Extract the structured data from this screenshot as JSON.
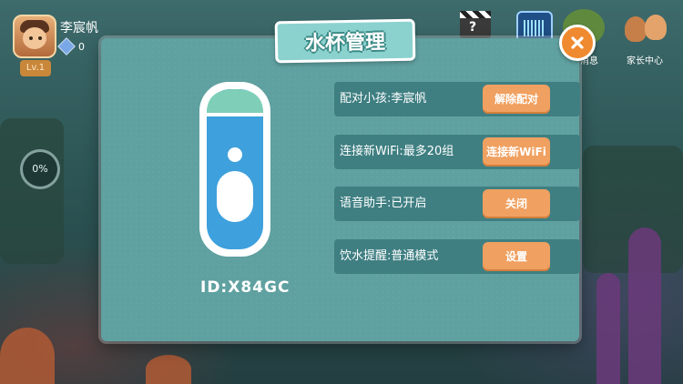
{
  "user": {
    "name": "李宸帆",
    "gems": "0",
    "level": "Lv.1"
  },
  "progress": {
    "value": "0%"
  },
  "top_icons": {
    "messages_label": "消息",
    "parent_center_label": "家长中心"
  },
  "modal": {
    "title": "水杯管理",
    "device_id": "ID:X84GC",
    "rows": [
      {
        "label": "配对小孩:李宸帆",
        "button": "解除配对"
      },
      {
        "label": "连接新WiFi:最多20组",
        "button": "连接新WiFi"
      },
      {
        "label": "语音助手:已开启",
        "button": "关闭"
      },
      {
        "label": "饮水提醒:普通模式",
        "button": "设置"
      }
    ]
  },
  "colors": {
    "panel": "#5fa0a0",
    "row": "#3f7f82",
    "button": "#f0a060",
    "close": "#f08a30"
  },
  "icons": {
    "close": "close-icon",
    "cup": "water-cup-icon",
    "gem": "gem-icon"
  }
}
